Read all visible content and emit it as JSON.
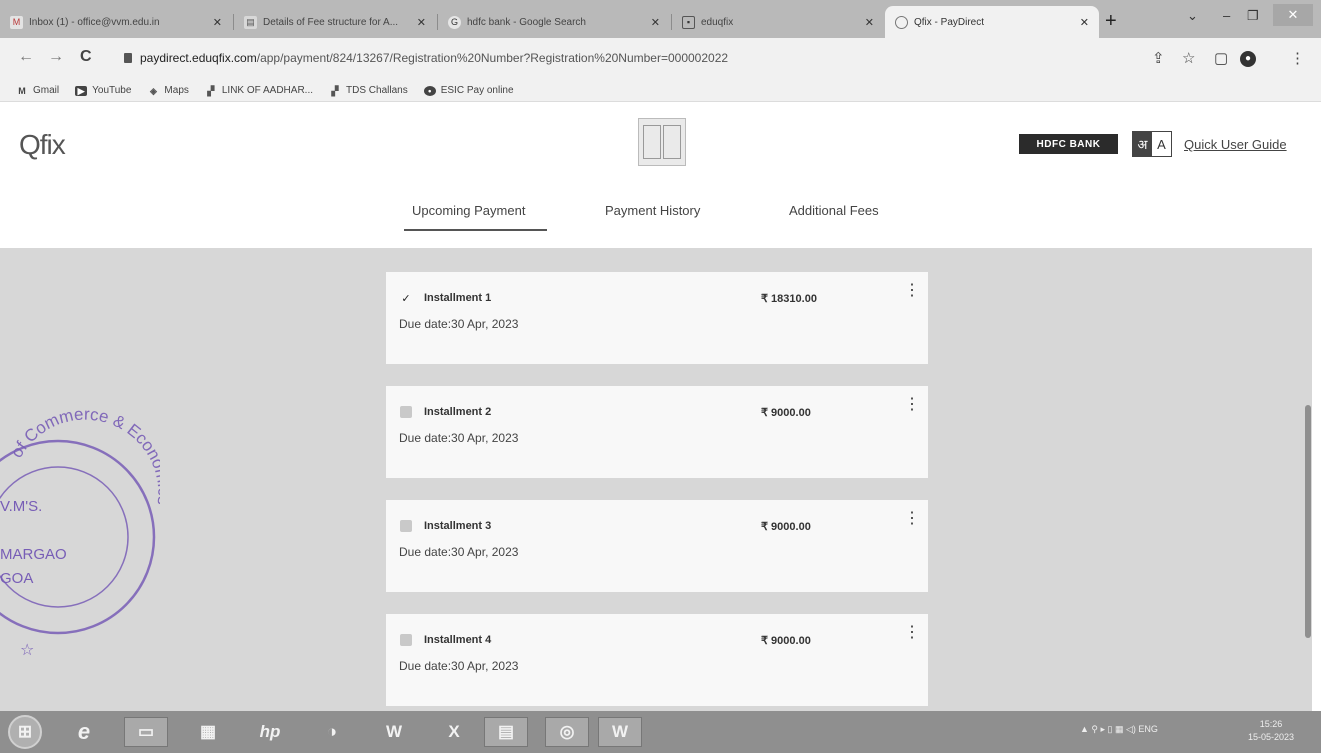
{
  "browser": {
    "tabs": [
      {
        "title": "Inbox (1) - office@vvm.edu.in",
        "icon": "gmail-icon"
      },
      {
        "title": "Details of Fee structure for A...",
        "icon": "doc-icon"
      },
      {
        "title": "hdfc bank - Google Search",
        "icon": "google-icon"
      },
      {
        "title": "eduqfix",
        "icon": "page-icon"
      },
      {
        "title": "Qfix - PayDirect",
        "icon": "qfix-icon"
      }
    ],
    "url_domain": "paydirect.eduqfix.com",
    "url_path": "/app/payment/824/13267/Registration%20Number?Registration%20Number=000002022",
    "bookmarks": [
      {
        "label": "Gmail",
        "icon": "gmail-icon"
      },
      {
        "label": "YouTube",
        "icon": "youtube-icon"
      },
      {
        "label": "Maps",
        "icon": "maps-icon"
      },
      {
        "label": "LINK OF AADHAR...",
        "icon": "folder-icon"
      },
      {
        "label": "TDS Challans",
        "icon": "folder-icon"
      },
      {
        "label": "ESIC Pay online",
        "icon": "globe-icon"
      }
    ]
  },
  "header": {
    "logo": "Qfix",
    "bank_logo": "HDFC BANK",
    "lang_toggle": [
      "अ",
      "A"
    ],
    "guide_link": "Quick User Guide"
  },
  "tabs": [
    "Upcoming Payment",
    "Payment History",
    "Additional Fees"
  ],
  "installments": [
    {
      "label": "Installment 1",
      "amount": "₹ 18310.00",
      "due": "Due date:30 Apr, 2023",
      "checked": true
    },
    {
      "label": "Installment 2",
      "amount": "₹ 9000.00",
      "due": "Due date:30 Apr, 2023",
      "checked": false
    },
    {
      "label": "Installment 3",
      "amount": "₹ 9000.00",
      "due": "Due date:30 Apr, 2023",
      "checked": false
    },
    {
      "label": "Installment 4",
      "amount": "₹ 9000.00",
      "due": "Due date:30 Apr, 2023",
      "checked": false
    }
  ],
  "stamp": {
    "ring": "of Commerce & Economics",
    "line1": "V.M'S.",
    "line2": "MARGAO",
    "line3": "GOA",
    "star": "☆"
  },
  "taskbar": {
    "tray_lang": "ENG",
    "time": "15:26",
    "date": "15-05-2023"
  }
}
